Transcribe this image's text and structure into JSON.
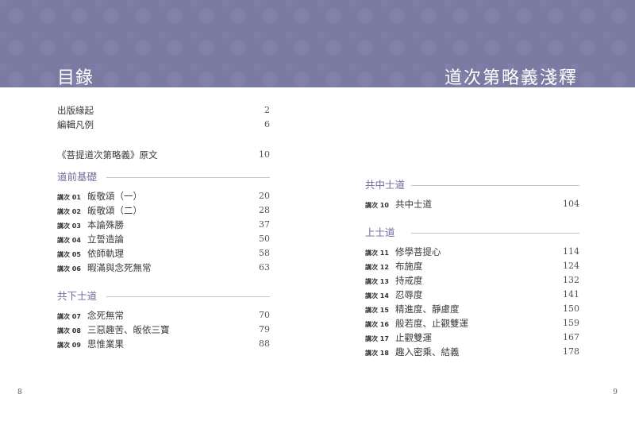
{
  "header": {
    "left_title": "目錄",
    "right_title": "道次第略義淺釋"
  },
  "front_matter": [
    {
      "title": "出版緣起",
      "page": "2"
    },
    {
      "title": "編輯凡例",
      "page": "6"
    }
  ],
  "source_text": {
    "title": "《菩提道次第略義》原文",
    "page": "10"
  },
  "left_sections": [
    {
      "heading": "道前基礎",
      "chapters": [
        {
          "code": "講次 01",
          "title": "皈敬頌（一）",
          "page": "20"
        },
        {
          "code": "講次 02",
          "title": "皈敬頌（二）",
          "page": "28"
        },
        {
          "code": "講次 03",
          "title": "本論殊勝",
          "page": "37"
        },
        {
          "code": "講次 04",
          "title": "立誓造論",
          "page": "50"
        },
        {
          "code": "講次 05",
          "title": "依師軌理",
          "page": "58"
        },
        {
          "code": "講次 06",
          "title": "暇滿與念死無常",
          "page": "63"
        }
      ]
    },
    {
      "heading": "共下士道",
      "chapters": [
        {
          "code": "講次 07",
          "title": "念死無常",
          "page": "70"
        },
        {
          "code": "講次 08",
          "title": "三惡趣苦、皈依三寶",
          "page": "79"
        },
        {
          "code": "講次 09",
          "title": "思惟業果",
          "page": "88"
        }
      ]
    }
  ],
  "right_sections": [
    {
      "heading": "共中士道",
      "chapters": [
        {
          "code": "講次 10",
          "title": "共中士道",
          "page": "104"
        }
      ]
    },
    {
      "heading": "上士道",
      "chapters": [
        {
          "code": "講次 11",
          "title": "修學菩提心",
          "page": "114"
        },
        {
          "code": "講次 12",
          "title": "布施度",
          "page": "124"
        },
        {
          "code": "講次 13",
          "title": "持戒度",
          "page": "132"
        },
        {
          "code": "講次 14",
          "title": "忍辱度",
          "page": "141"
        },
        {
          "code": "講次 15",
          "title": "精進度、靜慮度",
          "page": "150"
        },
        {
          "code": "講次 16",
          "title": "般若度、止觀雙運",
          "page": "159"
        },
        {
          "code": "講次 17",
          "title": "止觀雙運",
          "page": "167"
        },
        {
          "code": "講次 18",
          "title": "趣入密乘、結義",
          "page": "178"
        }
      ]
    }
  ],
  "folios": {
    "left": "8",
    "right": "9"
  }
}
